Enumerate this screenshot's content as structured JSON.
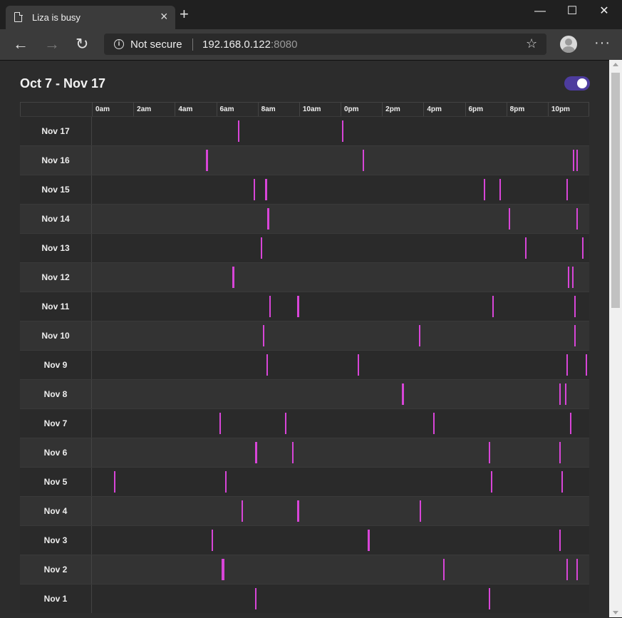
{
  "browser": {
    "tab_title": "Liza is busy",
    "tab_close": "×",
    "new_tab": "+",
    "security_text": "Not secure",
    "url_host": "192.168.0.122",
    "url_port": ":8080",
    "window_minimize": "—",
    "window_maximize": "☐",
    "window_close": "✕",
    "nav_back": "←",
    "nav_forward": "→",
    "nav_refresh": "↻",
    "star": "☆",
    "menu": "···"
  },
  "page": {
    "title": "Oct 7 - Nov 17",
    "toggle_on": true,
    "accent": "#d845d8",
    "toggle_color": "#4d3c9e"
  },
  "hours": [
    "0am",
    "2am",
    "4am",
    "6am",
    "8am",
    "10am",
    "0pm",
    "2pm",
    "4pm",
    "6pm",
    "8pm",
    "10pm"
  ],
  "chart_data": {
    "type": "timeline",
    "x_unit": "hour of day",
    "xlim": [
      0,
      24
    ],
    "rows": [
      {
        "date": "Nov 17",
        "events": [
          {
            "t": 7.1,
            "w": 0.05
          },
          {
            "t": 12.1,
            "w": 0.05
          }
        ]
      },
      {
        "date": "Nov 16",
        "events": [
          {
            "t": 5.55,
            "w": 0.1
          },
          {
            "t": 13.1,
            "w": 0.05
          },
          {
            "t": 23.25,
            "w": 0.05
          },
          {
            "t": 23.4,
            "w": 0.05
          }
        ]
      },
      {
        "date": "Nov 15",
        "events": [
          {
            "t": 7.85,
            "w": 0.05
          },
          {
            "t": 8.4,
            "w": 0.08
          },
          {
            "t": 18.95,
            "w": 0.05
          },
          {
            "t": 19.7,
            "w": 0.05
          },
          {
            "t": 22.95,
            "w": 0.05
          }
        ]
      },
      {
        "date": "Nov 14",
        "events": [
          {
            "t": 8.5,
            "w": 0.08
          },
          {
            "t": 20.15,
            "w": 0.05
          },
          {
            "t": 23.4,
            "w": 0.05
          }
        ]
      },
      {
        "date": "Nov 13",
        "events": [
          {
            "t": 8.2,
            "w": 0.05
          },
          {
            "t": 20.95,
            "w": 0.05
          },
          {
            "t": 23.7,
            "w": 0.05
          }
        ]
      },
      {
        "date": "Nov 12",
        "events": [
          {
            "t": 6.8,
            "w": 0.1
          },
          {
            "t": 23.0,
            "w": 0.05
          },
          {
            "t": 23.2,
            "w": 0.05
          }
        ]
      },
      {
        "date": "Nov 11",
        "events": [
          {
            "t": 8.6,
            "w": 0.05
          },
          {
            "t": 9.95,
            "w": 0.08
          },
          {
            "t": 19.35,
            "w": 0.05
          },
          {
            "t": 23.3,
            "w": 0.05
          }
        ]
      },
      {
        "date": "Nov 10",
        "events": [
          {
            "t": 8.3,
            "w": 0.05
          },
          {
            "t": 15.8,
            "w": 0.1
          },
          {
            "t": 23.3,
            "w": 0.05
          }
        ]
      },
      {
        "date": "Nov 9",
        "events": [
          {
            "t": 8.45,
            "w": 0.05
          },
          {
            "t": 12.85,
            "w": 0.05
          },
          {
            "t": 22.95,
            "w": 0.05
          },
          {
            "t": 23.85,
            "w": 0.05
          }
        ]
      },
      {
        "date": "Nov 8",
        "events": [
          {
            "t": 15.0,
            "w": 0.08
          },
          {
            "t": 22.6,
            "w": 0.05
          },
          {
            "t": 22.85,
            "w": 0.05
          }
        ]
      },
      {
        "date": "Nov 7",
        "events": [
          {
            "t": 6.2,
            "w": 0.05
          },
          {
            "t": 9.35,
            "w": 0.08
          },
          {
            "t": 16.5,
            "w": 0.05
          },
          {
            "t": 23.1,
            "w": 0.05
          }
        ]
      },
      {
        "date": "Nov 6",
        "events": [
          {
            "t": 7.9,
            "w": 0.1
          },
          {
            "t": 9.7,
            "w": 0.05
          },
          {
            "t": 19.2,
            "w": 0.05
          },
          {
            "t": 22.6,
            "w": 0.05
          }
        ]
      },
      {
        "date": "Nov 5",
        "events": [
          {
            "t": 1.1,
            "w": 0.05
          },
          {
            "t": 6.45,
            "w": 0.05
          },
          {
            "t": 19.3,
            "w": 0.05
          },
          {
            "t": 22.7,
            "w": 0.05
          }
        ]
      },
      {
        "date": "Nov 4",
        "events": [
          {
            "t": 7.25,
            "w": 0.05
          },
          {
            "t": 9.95,
            "w": 0.08
          },
          {
            "t": 15.85,
            "w": 0.05
          }
        ]
      },
      {
        "date": "Nov 3",
        "events": [
          {
            "t": 5.8,
            "w": 0.08
          },
          {
            "t": 13.35,
            "w": 0.08
          },
          {
            "t": 22.6,
            "w": 0.05
          }
        ]
      },
      {
        "date": "Nov 2",
        "events": [
          {
            "t": 6.3,
            "w": 0.12
          },
          {
            "t": 17.0,
            "w": 0.05
          },
          {
            "t": 22.95,
            "w": 0.05
          },
          {
            "t": 23.4,
            "w": 0.05
          }
        ]
      },
      {
        "date": "Nov 1",
        "events": [
          {
            "t": 7.9,
            "w": 0.05
          },
          {
            "t": 19.2,
            "w": 0.05
          }
        ]
      }
    ]
  }
}
